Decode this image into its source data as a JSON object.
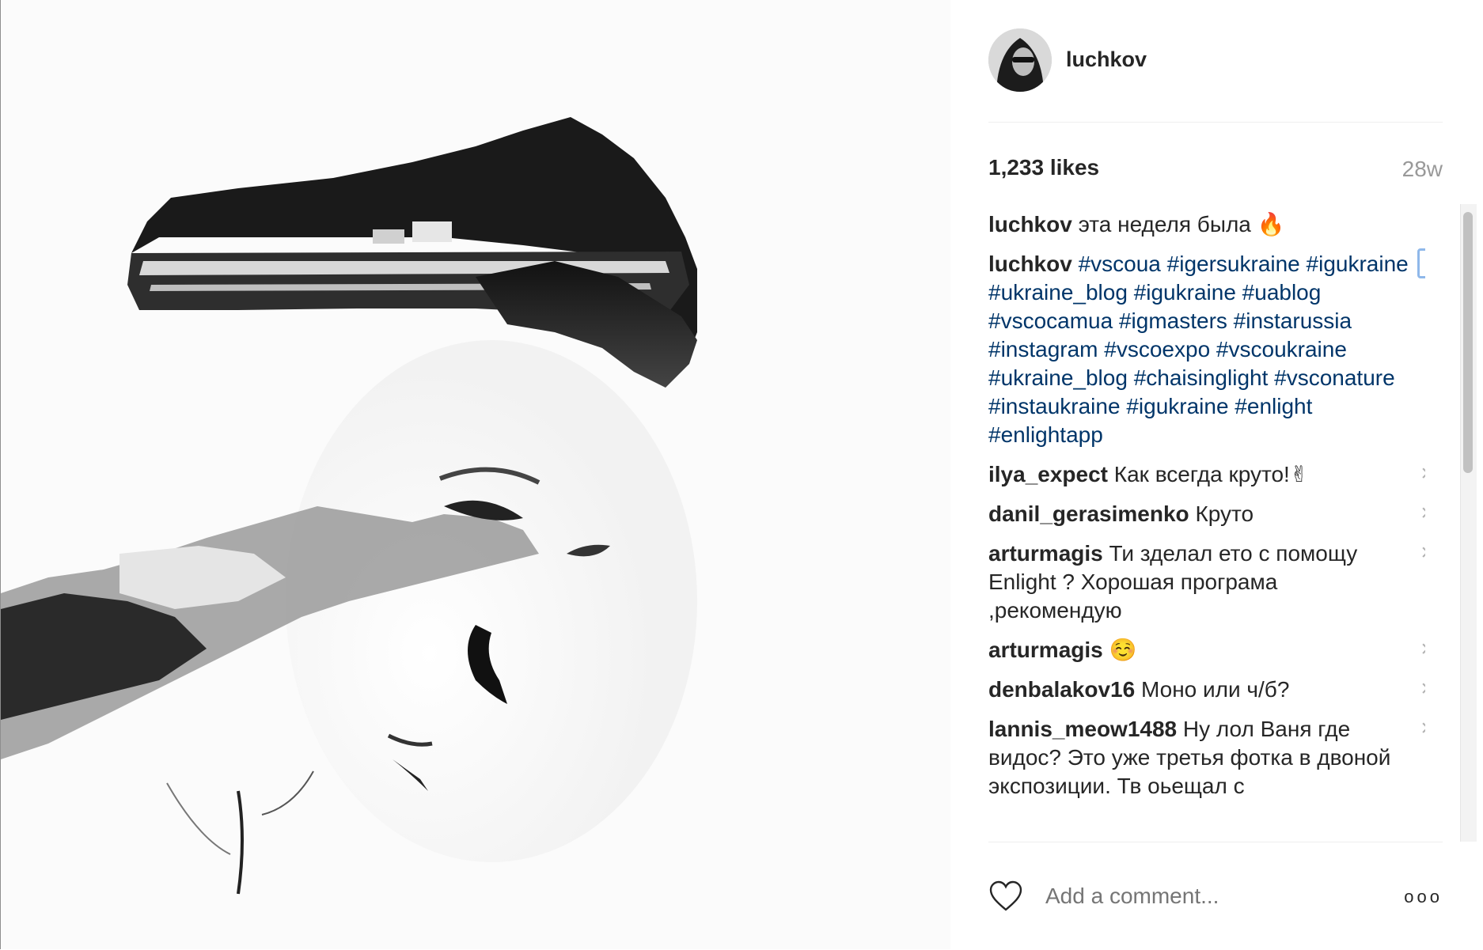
{
  "post": {
    "username": "luchkov",
    "likes": "1,233 likes",
    "age": "28w"
  },
  "comments": [
    {
      "author": "luchkov",
      "text": "эта неделя была 🔥",
      "tags": "",
      "deletable": false
    },
    {
      "author": "luchkov",
      "text": "",
      "tags": "#vscoua #igersukraine #igukraine #ukraine_blog #igukraine #uablog #vscocamua #igmasters #instarussia #instagram #vscoexpo #vscoukraine #ukraine_blog #chaisinglight #vsconature #instaukraine #igukraine #enlight #enlightapp",
      "deletable": true
    },
    {
      "author": "ilya_expect",
      "text": "Как всегда круто!✌",
      "tags": "",
      "deletable": true
    },
    {
      "author": "danil_gerasimenko",
      "text": "Круто",
      "tags": "",
      "deletable": true
    },
    {
      "author": "arturmagis",
      "text": "Ти зделал ето с помощу Enlight ? Хорошая програма ,рекомендую",
      "tags": "",
      "deletable": true
    },
    {
      "author": "arturmagis",
      "text": "☺️",
      "tags": "",
      "deletable": true
    },
    {
      "author": "denbalakov16",
      "text": "Моно или ч/б?",
      "tags": "",
      "deletable": true
    },
    {
      "author": "lannis_meow1488",
      "text": "Ну лол Ваня где видос? Это уже третья фотка в двоной экспозиции. Тв оьещал с",
      "tags": "",
      "deletable": true
    }
  ],
  "footer": {
    "comment_placeholder": "Add a comment...",
    "more_label": "ooo"
  },
  "icons": {
    "delete": "close-icon",
    "like": "heart-icon",
    "more": "more-options-icon"
  },
  "colors": {
    "hashtag": "#003569",
    "muted": "#999999",
    "text": "#262626"
  }
}
